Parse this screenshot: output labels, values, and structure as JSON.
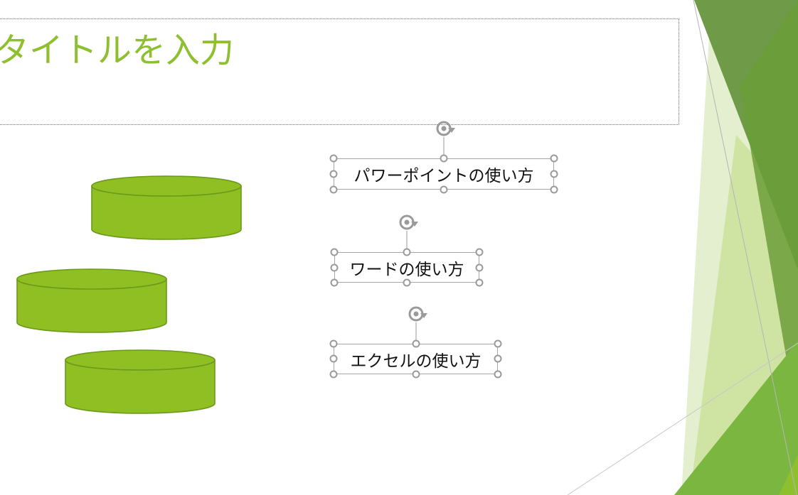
{
  "slide": {
    "title_placeholder": "タイトルを入力",
    "text_boxes": [
      {
        "label": "パワーポイントの使い方"
      },
      {
        "label": "ワードの使い方"
      },
      {
        "label": "エクセルの使い方"
      }
    ]
  },
  "theme": {
    "accent": "#8dbf2e",
    "shape_fill": "#8fbf22",
    "shape_outline": "#6a9a1a",
    "selection_handle": "#9a9a9a"
  }
}
